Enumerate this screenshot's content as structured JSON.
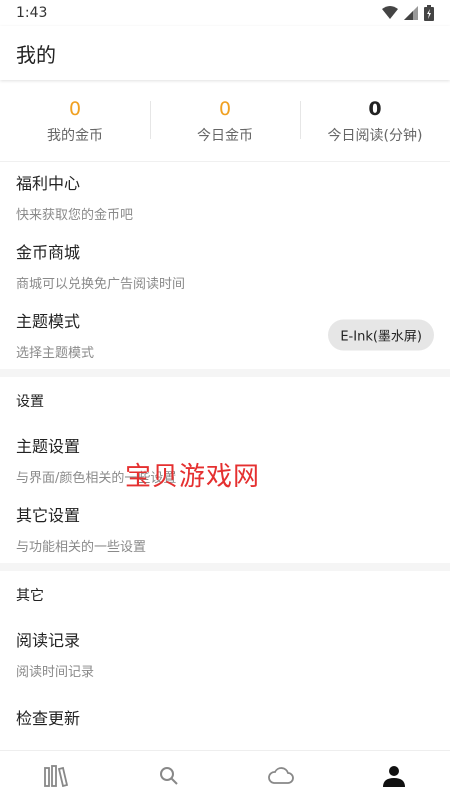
{
  "status_bar": {
    "time": "1:43"
  },
  "header": {
    "title": "我的"
  },
  "stats": [
    {
      "value": "0",
      "label": "我的金币"
    },
    {
      "value": "0",
      "label": "今日金币"
    },
    {
      "value": "0",
      "label": "今日阅读(分钟)"
    }
  ],
  "menu": {
    "welfare": {
      "title": "福利中心",
      "subtitle": "快来获取您的金币吧"
    },
    "coin_store": {
      "title": "金币商城",
      "subtitle": "商城可以兑换免广告阅读时间"
    },
    "theme_mode": {
      "title": "主题模式",
      "subtitle": "选择主题模式",
      "value": "E-Ink(墨水屏)"
    }
  },
  "settings": {
    "header": "设置",
    "theme_settings": {
      "title": "主题设置",
      "subtitle": "与界面/颜色相关的一些设置"
    },
    "other_settings": {
      "title": "其它设置",
      "subtitle": "与功能相关的一些设置"
    }
  },
  "others": {
    "header": "其它",
    "reading_history": {
      "title": "阅读记录",
      "subtitle": "阅读时间记录"
    },
    "check_update": {
      "title": "检查更新"
    }
  },
  "watermark": "宝贝游戏网",
  "bottom_nav": [
    {
      "icon": "bookshelf-icon"
    },
    {
      "icon": "search-icon"
    },
    {
      "icon": "cloud-icon"
    },
    {
      "icon": "person-icon",
      "active": true
    }
  ],
  "colors": {
    "accent": "#f0a020",
    "active_nav": "#111111",
    "inactive_nav": "#888888"
  }
}
